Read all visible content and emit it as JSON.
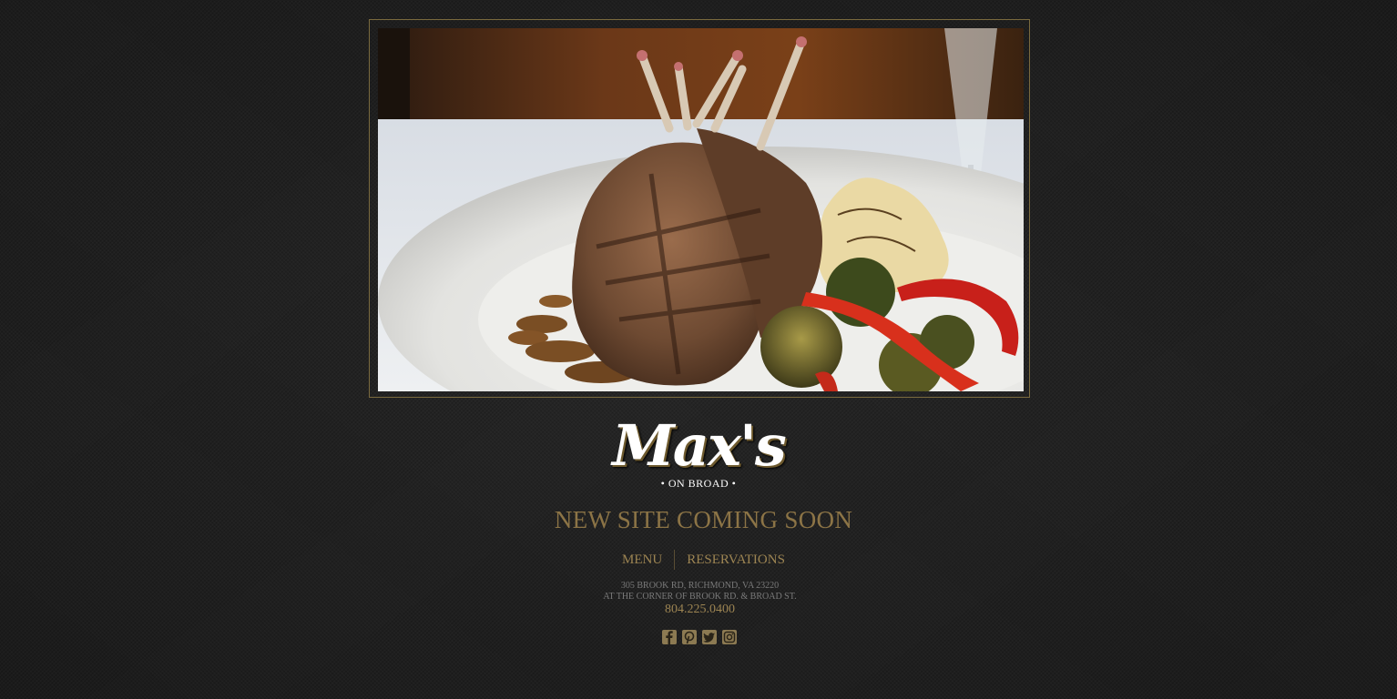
{
  "hero": {
    "image_alt": "Grilled rack of lamb with roasted brussels sprouts, red peppers and mashed potatoes"
  },
  "logo": {
    "wordmark": "Max's",
    "subline": "• ON BROAD •"
  },
  "headline": "NEW SITE COMING SOON",
  "nav": {
    "menu_label": "MENU",
    "reservations_label": "RESERVATIONS"
  },
  "contact": {
    "address_line1": "305 BROOK RD, RICHMOND, VA 23220",
    "address_line2": "AT THE CORNER OF BROOK RD. & BROAD ST.",
    "phone": "804.225.0400"
  },
  "social": {
    "icons": [
      "facebook-icon",
      "pinterest-icon",
      "twitter-icon",
      "instagram-icon"
    ]
  },
  "colors": {
    "background": "#1e1e1e",
    "gold": "#9c8452",
    "headline_gold": "#8c7446",
    "frame_border": "#7a6a3e",
    "address_gray": "#7a7a7a"
  }
}
